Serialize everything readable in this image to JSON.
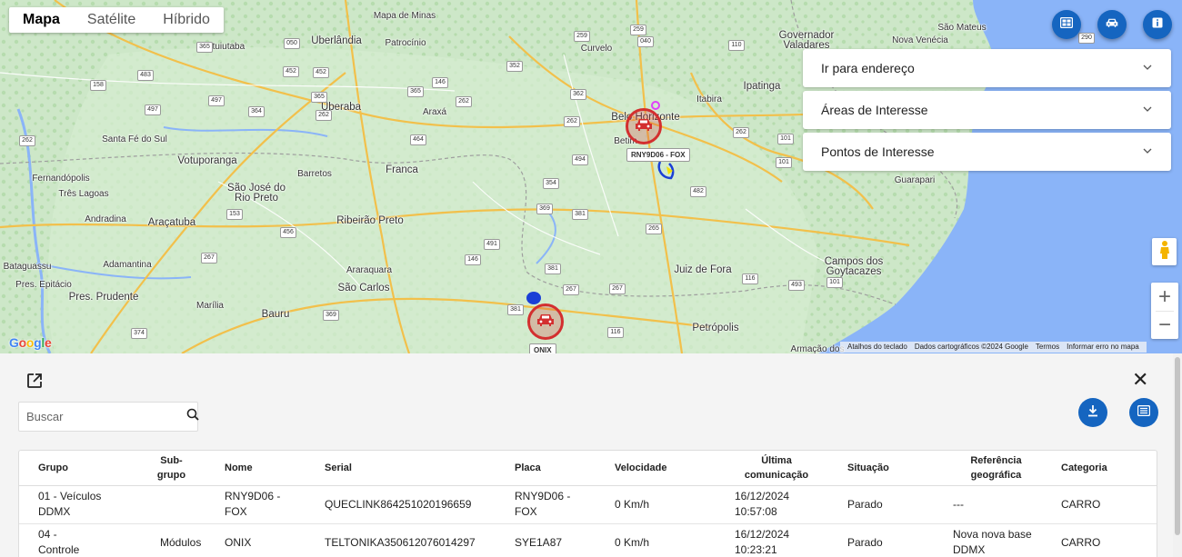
{
  "map": {
    "maptype_tabs": [
      {
        "label": "Mapa",
        "active": true
      },
      {
        "label": "Satélite",
        "active": false
      },
      {
        "label": "Híbrido",
        "active": false
      }
    ],
    "top_buttons": [
      {
        "name": "dashboard-icon",
        "color": "#1565c0"
      },
      {
        "name": "car-icon",
        "color": "#1565c0"
      },
      {
        "name": "info-icon",
        "color": "#1565c0"
      }
    ],
    "accordions": [
      {
        "label": "Ir para endereço"
      },
      {
        "label": "Áreas de Interesse"
      },
      {
        "label": "Pontos de Interesse"
      }
    ],
    "vehicle_markers": [
      {
        "label": "RNY9D06 - FOX"
      },
      {
        "label": "ONIX"
      }
    ],
    "places": [
      "Mapa de Minas",
      "Uberlândia",
      "Patrocínio",
      "Ituiutaba",
      "Uberaba",
      "Araxá",
      "Belo Horizonte",
      "Betim",
      "Curvelo",
      "Itabira",
      "Ipatinga",
      "Governador Valadares",
      "Nova Venécia",
      "São Mateus",
      "Santa Fé do Sul",
      "Votuporanga",
      "São José do Rio Preto",
      "Fernandópolis",
      "Três Lagoas",
      "Andradina",
      "Araçatuba",
      "Barretos",
      "Franca",
      "Ribeirão Preto",
      "Adamantina",
      "Bataguassu",
      "Pres. Epitácio",
      "Pres. Prudente",
      "Marília",
      "Araraquara",
      "São Carlos",
      "Bauru",
      "Juiz de Fora",
      "Petrópolis",
      "Campos dos Goytacazes",
      "Guarapari",
      "Armação dos Búzios"
    ],
    "google_logo": "Google",
    "attribution": [
      "Atalhos do teclado",
      "Dados cartográficos ©2024 Google",
      "Termos",
      "Informar erro no mapa"
    ],
    "zoom_in": "+",
    "zoom_out": "−"
  },
  "panel": {
    "search_placeholder": "Buscar",
    "close_label": "✕",
    "columns": [
      "Grupo",
      "Sub-grupo",
      "Nome",
      "Serial",
      "Placa",
      "Velocidade",
      "Última comunicação",
      "Situação",
      "Referência geográfica",
      "Categoria"
    ],
    "rows": [
      {
        "grupo": "01 - Veículos DDMX",
        "subgrupo": "",
        "nome": "RNY9D06 - FOX",
        "serial": "QUECLINK864251020196659",
        "placa": "RNY9D06 - FOX",
        "velocidade": "0 Km/h",
        "ultima": "16/12/2024 10:57:08",
        "situacao": "Parado",
        "referencia": "---",
        "categoria": "CARRO"
      },
      {
        "grupo": "04 - Controle",
        "subgrupo": "Módulos",
        "nome": "ONIX",
        "serial": "TELTONIKA350612076014297",
        "placa": "SYE1A87",
        "velocidade": "0 Km/h",
        "ultima": "16/12/2024 10:23:21",
        "situacao": "Parado",
        "referencia": "Nova nova base DDMX",
        "categoria": "CARRO"
      }
    ]
  },
  "colors": {
    "accent": "#1565c0",
    "map_land": "#cde7c8",
    "map_sea": "#8ab4f8",
    "marker_red": "#d32f2f"
  }
}
